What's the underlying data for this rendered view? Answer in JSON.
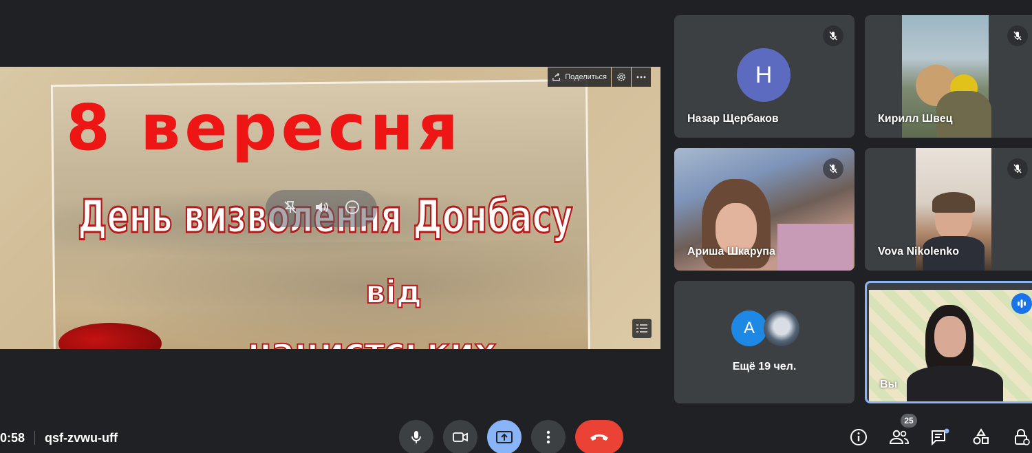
{
  "presentation": {
    "slide_title": "8 вересня",
    "slide_subtitle": "День визволення Донбасу",
    "slide_line3": "від",
    "slide_line4": "нацистських",
    "share_label": "Поделиться"
  },
  "participants": [
    {
      "name": "Назар Щербаков",
      "avatar_letter": "Н",
      "avatar_color": "#5c6bc0",
      "muted": true
    },
    {
      "name": "Кирилл Швец",
      "muted": true
    },
    {
      "name": "Ариша Шкарупа",
      "muted": true
    },
    {
      "name": "Vova Nikolenko",
      "muted": true
    },
    {
      "name": "Ещё 19 чел.",
      "avatar_letter": "А",
      "avatar_color": "#1e88e5"
    },
    {
      "name": "Вы",
      "speaking": true
    }
  ],
  "meeting": {
    "time": "0:58",
    "code": "qsf-zvwu-uff",
    "participant_count": "25"
  },
  "colors": {
    "background": "#202124",
    "tile": "#3c4043",
    "accent": "#8ab4f8",
    "end_call": "#ea4335",
    "slide_red": "#ee1515"
  }
}
